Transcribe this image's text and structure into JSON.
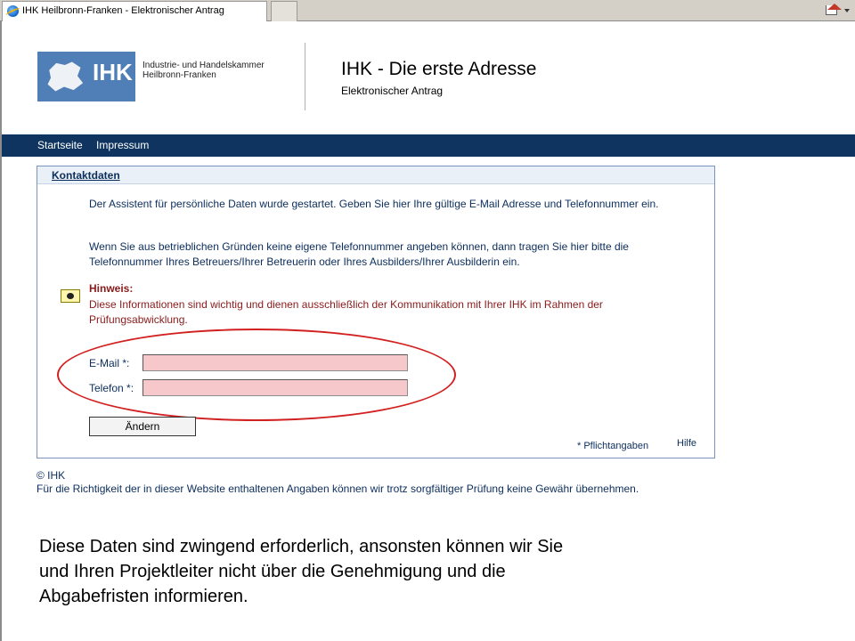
{
  "browser": {
    "tab_title": "IHK Heilbronn-Franken - Elektronischer Antrag"
  },
  "header": {
    "logo_text": "IHK",
    "org_line1": "Industrie- und Handelskammer",
    "org_line2": "Heilbronn-Franken",
    "title": "IHK - Die erste Adresse",
    "subtitle": "Elektronischer Antrag"
  },
  "nav": {
    "items": [
      {
        "label": "Startseite"
      },
      {
        "label": "Impressum"
      }
    ]
  },
  "panel": {
    "title": "Kontaktdaten",
    "para1": "Der Assistent für persönliche Daten wurde gestartet. Geben Sie hier Ihre gültige E-Mail Adresse und Telefonnummer ein.",
    "para2": "Wenn Sie aus betrieblichen Gründen keine eigene Telefonnummer angeben können, dann tragen Sie hier bitte die Telefonnummer Ihres Betreuers/Ihrer Betreuerin oder Ihres Ausbilders/Ihrer Ausbilderin ein.",
    "hint_title": "Hinweis:",
    "hint_text": "Diese Informationen sind wichtig und dienen ausschließlich der Kommunikation mit Ihrer IHK im Rahmen der Prüfungsabwicklung.",
    "email_label": "E-Mail *:",
    "email_value": "",
    "phone_label": "Telefon *:",
    "phone_value": "",
    "change_button": "Ändern",
    "required_note": "* Pflichtangaben",
    "help_link": "Hilfe"
  },
  "footer": {
    "copyright": "© IHK",
    "disclaimer": "Für die Richtigkeit der in dieser Website enthaltenen Angaben können wir trotz sorgfältiger Prüfung keine Gewähr übernehmen."
  },
  "caption": {
    "text": "Diese Daten sind zwingend erforderlich, ansonsten können wir Sie und Ihren Projektleiter nicht über die Genehmigung und die Abgabefristen informieren."
  },
  "colors": {
    "nav_bg": "#0f3460",
    "logo_bg": "#4f7fb6",
    "text_blue": "#0b2d5c",
    "hint_red": "#8b1a1a",
    "field_bg": "#f6c8cc",
    "highlight_ellipse": "#d22020"
  },
  "icons": {
    "favicon": "ie-globe-icon",
    "home": "home-icon",
    "note": "info-card-icon"
  }
}
